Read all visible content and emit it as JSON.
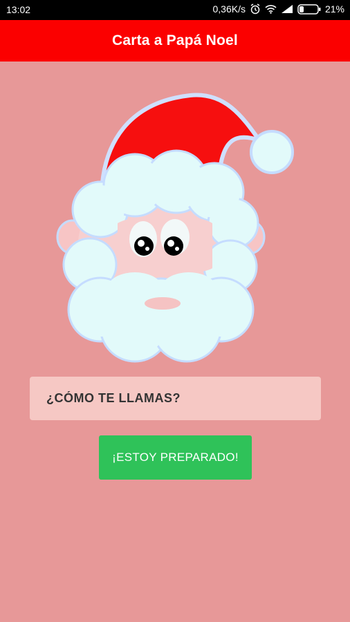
{
  "status_bar": {
    "time": "13:02",
    "network_speed": "0,36K/s",
    "battery": "21%",
    "icons": [
      "alarm-icon",
      "wifi-icon",
      "signal-icon",
      "battery-icon"
    ]
  },
  "app_bar": {
    "title": "Carta a Papá Noel"
  },
  "main": {
    "illustration": "santa-face-icon",
    "name_input": {
      "placeholder": "¿CÓMO TE LLAMAS?",
      "value": ""
    },
    "ready_button": {
      "label": "¡ESTOY PREPARADO!"
    }
  },
  "colors": {
    "background": "#e79898",
    "app_bar": "#fb0000",
    "input_bg": "#f6c8c4",
    "button": "#2fc259"
  }
}
